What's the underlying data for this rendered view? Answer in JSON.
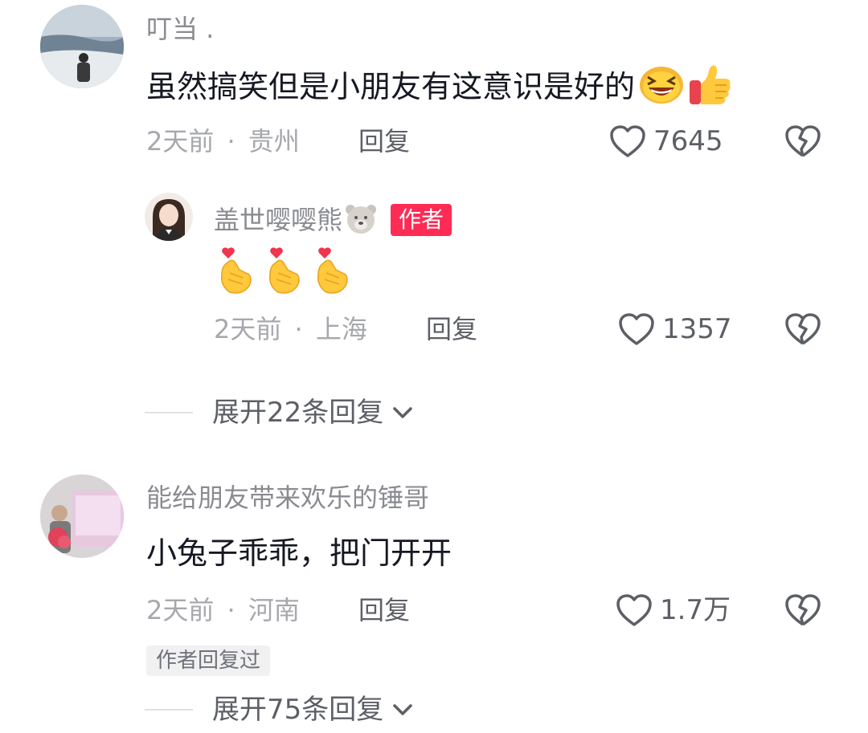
{
  "comments": [
    {
      "username": "叮当 .",
      "content": "虽然搞笑但是小朋友有这意识是好的",
      "emojis": [
        "laughing-emoji",
        "thumbs-up-emoji"
      ],
      "time": "2天前",
      "location": "贵州",
      "reply_label": "回复",
      "likes": "7645",
      "reply": {
        "username": "盖世嘤嘤熊",
        "username_emoji": "bear-face-emoji",
        "badge": "作者",
        "content_emojis": [
          "finger-heart-emoji",
          "finger-heart-emoji",
          "finger-heart-emoji"
        ],
        "time": "2天前",
        "location": "上海",
        "reply_label": "回复",
        "likes": "1357"
      },
      "expand_label": "展开22条回复"
    },
    {
      "username": "能给朋友带来欢乐的锤哥",
      "content": "小兔子乖乖，把门开开",
      "time": "2天前",
      "location": "河南",
      "reply_label": "回复",
      "likes": "1.7万",
      "author_replied_tag": "作者回复过",
      "expand_label": "展开75条回复"
    }
  ],
  "meta_separator": "·",
  "colors": {
    "badge": "#fe2c55",
    "text_primary": "#161823",
    "text_secondary": "#8a8b91",
    "text_meta": "#a7a8ad"
  }
}
